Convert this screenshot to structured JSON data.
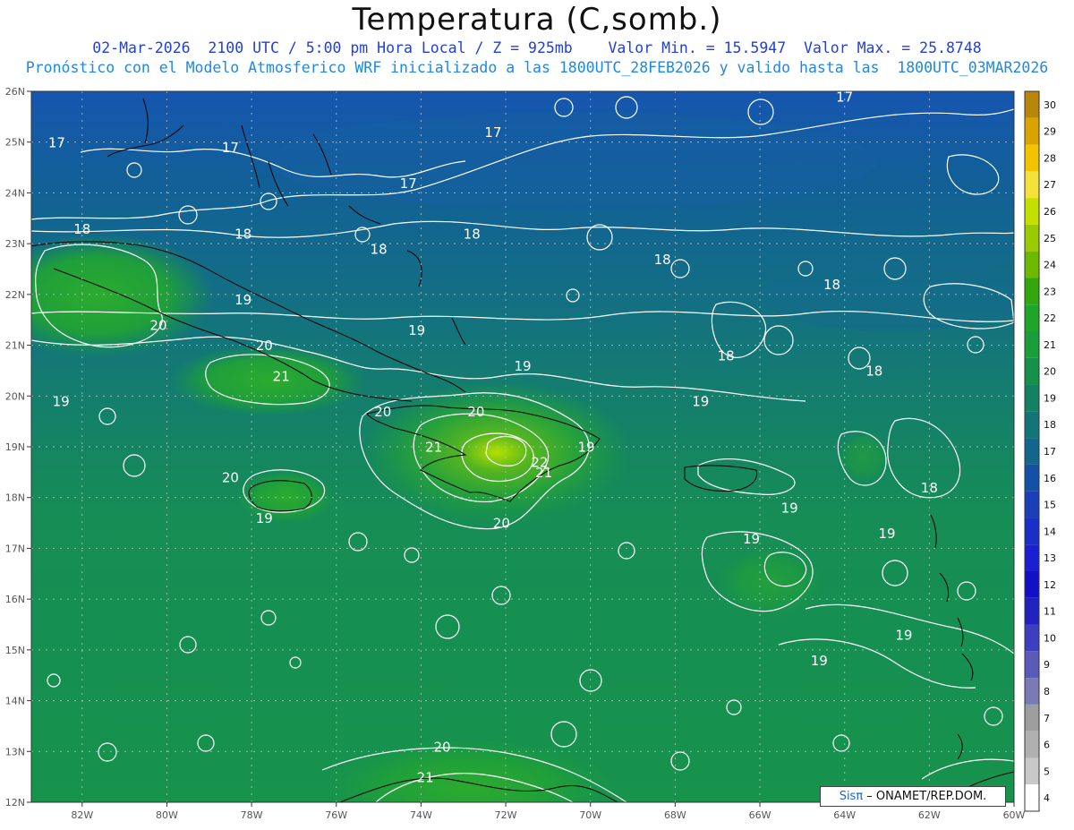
{
  "header": {
    "title": "Temperatura (C,somb.)",
    "line1": "02-Mar-2026  2100 UTC / 5:00 pm Hora Local / Z = 925mb    Valor Min. = 15.5947  Valor Max. = 25.8748",
    "line2": "Pronóstico con el Modelo Atmosferico WRF inicializado a las 1800UTC_28FEB2026 y valido hasta las  1800UTC_03MAR2026"
  },
  "map": {
    "lat_labels": [
      "26N",
      "25N",
      "24N",
      "23N",
      "22N",
      "21N",
      "20N",
      "19N",
      "18N",
      "17N",
      "16N",
      "15N",
      "14N",
      "13N",
      "12N"
    ],
    "lon_labels": [
      "82W",
      "80W",
      "78W",
      "76W",
      "74W",
      "72W",
      "70W",
      "68W",
      "66W",
      "64W",
      "62W",
      "60W"
    ],
    "lat_range": [
      12,
      26
    ],
    "lon_range": [
      -83.2,
      -60
    ],
    "contour_labels": [
      {
        "t": "17",
        "lon": -82.6,
        "lat": 24.9
      },
      {
        "t": "17",
        "lon": -78.5,
        "lat": 24.8
      },
      {
        "t": "17",
        "lon": -74.3,
        "lat": 24.1
      },
      {
        "t": "17",
        "lon": -72.3,
        "lat": 25.1
      },
      {
        "t": "17",
        "lon": -64,
        "lat": 25.8
      },
      {
        "t": "18",
        "lon": -82.0,
        "lat": 23.2
      },
      {
        "t": "18",
        "lon": -78.2,
        "lat": 23.1
      },
      {
        "t": "18",
        "lon": -75.0,
        "lat": 22.8
      },
      {
        "t": "18",
        "lon": -72.8,
        "lat": 23.1
      },
      {
        "t": "18",
        "lon": -68.3,
        "lat": 22.6
      },
      {
        "t": "18",
        "lon": -64.3,
        "lat": 22.1
      },
      {
        "t": "18",
        "lon": -66.8,
        "lat": 20.7
      },
      {
        "t": "18",
        "lon": -63.3,
        "lat": 20.4
      },
      {
        "t": "18",
        "lon": -62.0,
        "lat": 18.1
      },
      {
        "t": "19",
        "lon": -78.2,
        "lat": 21.8
      },
      {
        "t": "19",
        "lon": -74.1,
        "lat": 21.2
      },
      {
        "t": "19",
        "lon": -71.6,
        "lat": 20.5
      },
      {
        "t": "19",
        "lon": -82.5,
        "lat": 19.8
      },
      {
        "t": "19",
        "lon": -67.4,
        "lat": 19.8
      },
      {
        "t": "19",
        "lon": -70.1,
        "lat": 18.9
      },
      {
        "t": "19",
        "lon": -77.7,
        "lat": 17.5
      },
      {
        "t": "19",
        "lon": -65.3,
        "lat": 17.7
      },
      {
        "t": "19",
        "lon": -66.2,
        "lat": 17.1
      },
      {
        "t": "19",
        "lon": -63.0,
        "lat": 17.2
      },
      {
        "t": "19",
        "lon": -62.6,
        "lat": 15.2
      },
      {
        "t": "19",
        "lon": -64.6,
        "lat": 14.7
      },
      {
        "t": "20",
        "lon": -80.2,
        "lat": 21.3
      },
      {
        "t": "20",
        "lon": -77.7,
        "lat": 20.9
      },
      {
        "t": "20",
        "lon": -74.9,
        "lat": 19.6
      },
      {
        "t": "20",
        "lon": -72.7,
        "lat": 19.6
      },
      {
        "t": "20",
        "lon": -78.5,
        "lat": 18.3
      },
      {
        "t": "20",
        "lon": -72.1,
        "lat": 17.4
      },
      {
        "t": "20",
        "lon": -73.5,
        "lat": 13.0
      },
      {
        "t": "21",
        "lon": -77.3,
        "lat": 20.3
      },
      {
        "t": "21",
        "lon": -73.7,
        "lat": 18.9
      },
      {
        "t": "21",
        "lon": -71.1,
        "lat": 18.4
      },
      {
        "t": "21",
        "lon": -73.9,
        "lat": 12.4
      },
      {
        "t": "22",
        "lon": -71.2,
        "lat": 18.6
      }
    ],
    "credit_brand": "Sisπ",
    "credit_rest": " – ONAMET/REP.DOM."
  },
  "colorbar": {
    "labels": [
      "30",
      "29",
      "28",
      "27",
      "26",
      "25",
      "24",
      "23",
      "22",
      "21",
      "20",
      "19",
      "18",
      "17",
      "16",
      "15",
      "14",
      "13",
      "12",
      "11",
      "10",
      "9",
      "8",
      "7",
      "6",
      "5",
      "4"
    ],
    "colors": [
      "#b8860b",
      "#d9a400",
      "#f2c300",
      "#f4e23a",
      "#c4e000",
      "#9acb00",
      "#6eb800",
      "#33a60e",
      "#1ea52a",
      "#199e3a",
      "#16914c",
      "#138162",
      "#137478",
      "#12668e",
      "#1451a6",
      "#1a3fb8",
      "#1a2ec8",
      "#1b1fd2",
      "#1410c6",
      "#2121c0",
      "#3e3ec0",
      "#5a5ab8",
      "#7a7ab4",
      "#9e9e9e",
      "#b0b0b0",
      "#c8c8c8",
      "#ffffff"
    ]
  }
}
